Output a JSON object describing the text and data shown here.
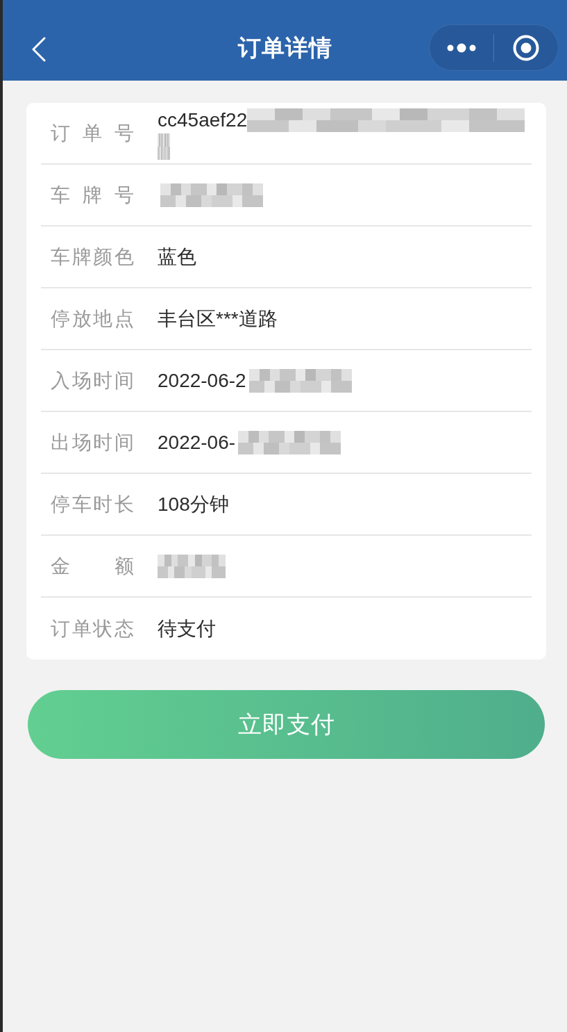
{
  "nav_bar": {
    "title": "订单详情"
  },
  "details": [
    {
      "kind": "masked_wrap",
      "label": "订单号",
      "value": "cc45aef22"
    },
    {
      "kind": "masked",
      "label": "车牌号"
    },
    {
      "kind": "plain",
      "label": "车牌颜色",
      "value": "蓝色"
    },
    {
      "kind": "plain",
      "label": "停放地点",
      "value": "丰台区***道路"
    },
    {
      "kind": "masked",
      "label": "入场时间",
      "value": "2022-06-2"
    },
    {
      "kind": "masked",
      "label": "出场时间",
      "value": "2022-06-"
    },
    {
      "kind": "plain",
      "label": "停车时长",
      "value": "108分钟"
    },
    {
      "kind": "masked_short",
      "label": "金额"
    },
    {
      "kind": "plain",
      "label": "订单状态",
      "value": "待支付"
    }
  ],
  "pay_button": {
    "label": "立即支付"
  }
}
